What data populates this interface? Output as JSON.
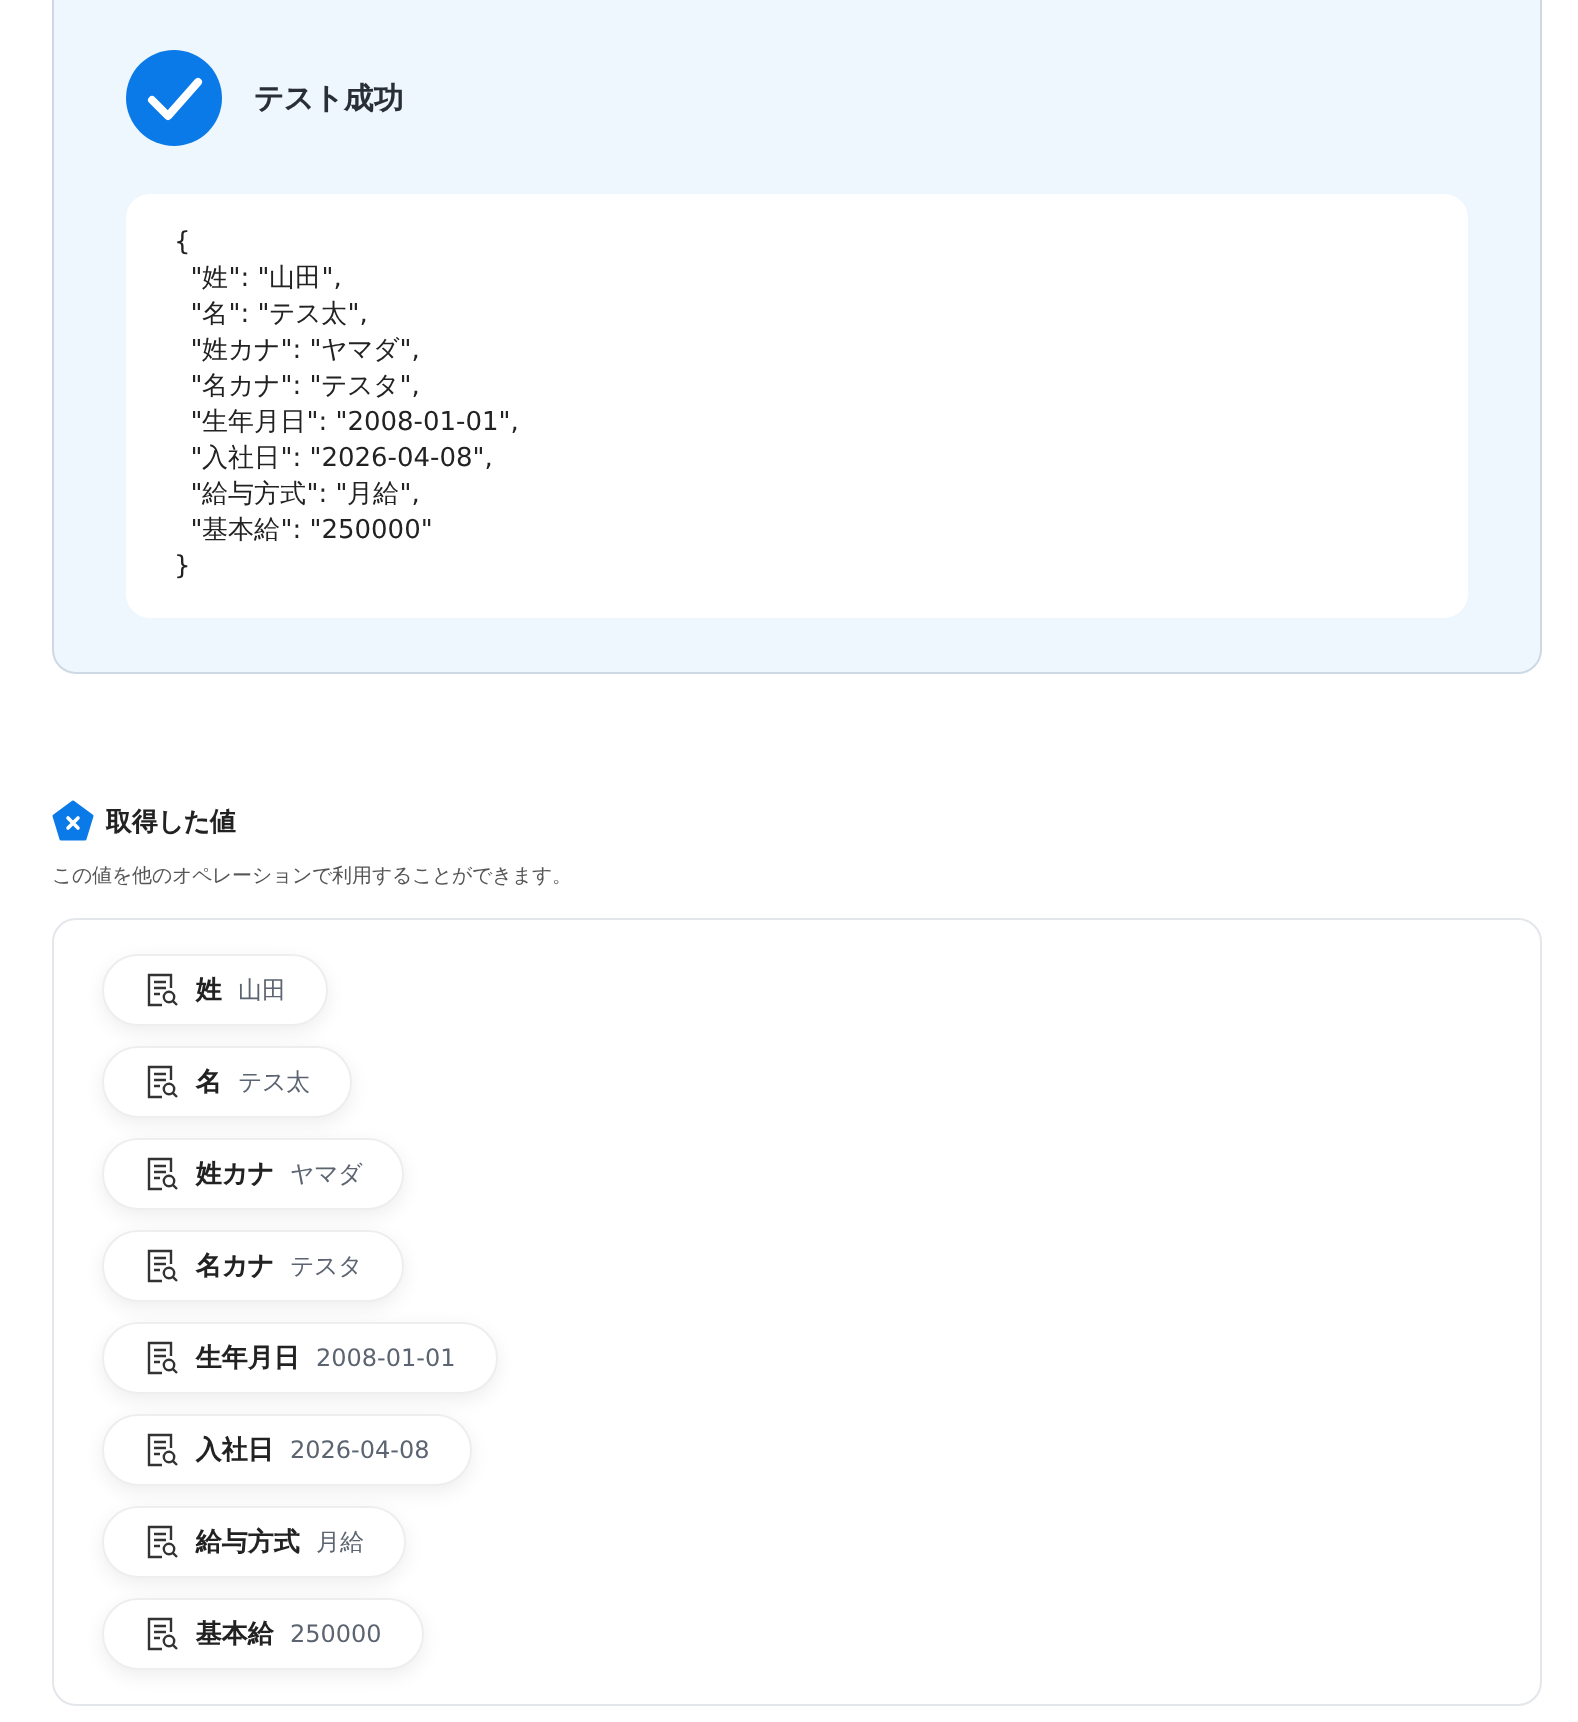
{
  "result": {
    "passed": true,
    "title": "テスト成功",
    "output": "{\n  \"姓\": \"山田\",\n  \"名\": \"テス太\",\n  \"姓カナ\": \"ヤマダ\",\n  \"名カナ\": \"テスタ\",\n  \"生年月日\": \"2008-01-01\",\n  \"入社日\": \"2026-04-08\",\n  \"給与方式\": \"月給\",\n  \"基本給\": \"250000\"\n}"
  },
  "values_section": {
    "title": "取得した値",
    "description": "この値を他のオペレーションで利用することができます。",
    "items": [
      {
        "name": "姓",
        "value": "山田"
      },
      {
        "name": "名",
        "value": "テス太"
      },
      {
        "name": "姓カナ",
        "value": "ヤマダ"
      },
      {
        "name": "名カナ",
        "value": "テスタ"
      },
      {
        "name": "生年月日",
        "value": "2008-01-01"
      },
      {
        "name": "入社日",
        "value": "2026-04-08"
      },
      {
        "name": "給与方式",
        "value": "月給"
      },
      {
        "name": "基本給",
        "value": "250000"
      }
    ]
  }
}
